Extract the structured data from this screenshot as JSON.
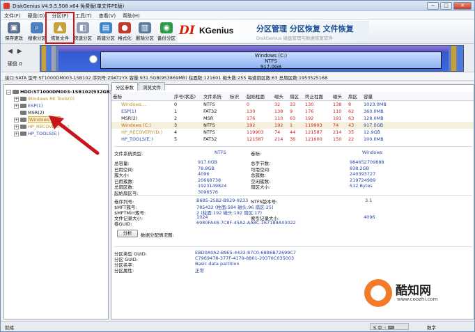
{
  "window": {
    "title": "DiskGenius V4.9.5.508 x64 免费版(单文件PE版)",
    "controls": [
      "−",
      "□",
      "✕"
    ]
  },
  "menu": [
    "文件(F)",
    "硬盘(D)",
    "分区(P)",
    "工具(T)",
    "查看(V)",
    "帮助(H)"
  ],
  "toolbar": [
    {
      "label": "保存更改",
      "icon": "save-icon",
      "color": "#5a6f8c"
    },
    {
      "label": "搜索分区",
      "icon": "search-icon",
      "color": "#4d7fbf"
    },
    {
      "label": "恢复文件",
      "icon": "recover-icon",
      "color": "#c9a13a"
    },
    {
      "label": "快速分区",
      "icon": "quick-partition-icon",
      "color": "#8d9cb0"
    },
    {
      "label": "新建分区",
      "icon": "new-partition-icon",
      "color": "#3f86c9"
    },
    {
      "label": "格式化",
      "icon": "format-icon",
      "color": "#c0392b"
    },
    {
      "label": "删除分区",
      "icon": "delete-icon",
      "color": "#5e7f9c"
    },
    {
      "label": "备份分区",
      "icon": "backup-icon",
      "color": "#2f9a4a"
    }
  ],
  "banner": {
    "logo_a": "DI",
    "logo_b": "KGenius",
    "slogan": "分区管理 分区恢复 文件恢复",
    "sub": "DiskGenius 磁盘管理与数据恢复软件"
  },
  "diskmap": {
    "nav": "◀ ▶",
    "disk_label": "硬盘 0",
    "partition_name": "Windows (C:)",
    "partition_fs": "NTFS",
    "partition_size": "917.0GB"
  },
  "infoline": "接口:SATA  型号:ST1000DM003-1SB102  序列号:Z9AT2YX  容量:931.5GB(953869MB)  柱面数:121601  磁头数:255  每道扇区数:63  总扇区数:1953525168",
  "tree": {
    "root": "HDD:ST1000DM003-1SB102(932GB)",
    "items": [
      {
        "label": "Windows RE Tools(0)",
        "color": "#b89224"
      },
      {
        "label": "ESP(1)",
        "color": "#2545a8"
      },
      {
        "label": "MSR(2)",
        "color": "#222"
      },
      {
        "label": "Windows (C:)",
        "color": "#c06a10"
      },
      {
        "label": "HP_RECOVERY(D:)",
        "color": "#b89224"
      },
      {
        "label": "HP_TOOLS(E:)",
        "color": "#2545a8"
      }
    ]
  },
  "tabs": [
    "分区参数",
    "浏览文件"
  ],
  "table": {
    "headers": [
      "卷标",
      "序号(状态)",
      "文件系统",
      "标识",
      "起始柱面",
      "磁头",
      "扇区",
      "终止柱面",
      "磁头",
      "扇区",
      "容量"
    ],
    "rows": [
      [
        "Windows...",
        "0",
        "NTFS",
        "",
        "0",
        "32",
        "33",
        "130",
        "138",
        "8",
        "1023.0MB"
      ],
      [
        "ESP(1)",
        "1",
        "FAT32",
        "",
        "130",
        "138",
        "9",
        "176",
        "110",
        "62",
        "360.0MB"
      ],
      [
        "MSR(2)",
        "2",
        "MSR",
        "",
        "176",
        "110",
        "63",
        "192",
        "191",
        "63",
        "128.0MB"
      ],
      [
        "Windows (C:)",
        "3",
        "NTFS",
        "",
        "192",
        "192",
        "1",
        "119903",
        "74",
        "43",
        "917.0GB"
      ],
      [
        "HP_RECOVERY(D:)",
        "4",
        "NTFS",
        "",
        "119903",
        "74",
        "44",
        "121587",
        "214",
        "35",
        "12.9GB"
      ],
      [
        "HP_TOOLS(E:)",
        "5",
        "FAT32",
        "",
        "121587",
        "214",
        "36",
        "121600",
        "150",
        "22",
        "100.0MB"
      ]
    ]
  },
  "details": {
    "fs_type_label": "文件系统类型:",
    "fs_type": "NTFS",
    "vol_label_label": "卷标:",
    "vol_label": "Windows",
    "left_labels": [
      "总容量:",
      "已用空间:",
      "簇大小:",
      "已用簇数:",
      "总扇区数:",
      "起始扇区号:"
    ],
    "left_values": [
      "917.0GB",
      "78.8GB",
      "4096",
      "20668738",
      "1923149824",
      "3096576"
    ],
    "right_labels": [
      "总字节数:",
      "可用空间:",
      "总簇数:",
      "空闲簇数:",
      "扇区大小:",
      ""
    ],
    "right_values": [
      "984652709888",
      "838.2GB",
      "240393727",
      "219724989",
      "512 Bytes",
      ""
    ],
    "serial_labels": [
      "卷序列号:",
      "$MFT簇号:",
      "$MFTMirr簇号:",
      "文件记录大小:",
      "卷GUID:"
    ],
    "serial_values": [
      "B6B5-25B2-B929-9233",
      "785432 (柱面:584 磁头:96 扇区:25)",
      "2 (柱面:192 磁头:192 扇区:17)",
      "1024",
      "6980FA48-7C8F-45A2-AA8C-167189A43022"
    ],
    "ntfs_label": "NTFS版本号:",
    "ntfs_value": "3.1",
    "index_label": "索引记录大小:",
    "index_value": "4096",
    "analyze_btn": "分析",
    "chart_label": "数据分配情况图:",
    "guid_labels": [
      "分区类型 GUID:",
      "分区 GUID:",
      "分区名字:",
      "分区属性:"
    ],
    "guid_values": [
      "EBD0A0A2-B9E5-4433-87C0-68B6B72699C7",
      "C7969478-377F-4179-8801-29370C035003",
      "Basic data partition",
      "正常"
    ]
  },
  "watermark": {
    "brand": "酷知网",
    "url": "www.coozhi.com"
  },
  "status": {
    "left": "就绪",
    "ime": "S 中 ◦ ⌨",
    "right": "数字"
  }
}
